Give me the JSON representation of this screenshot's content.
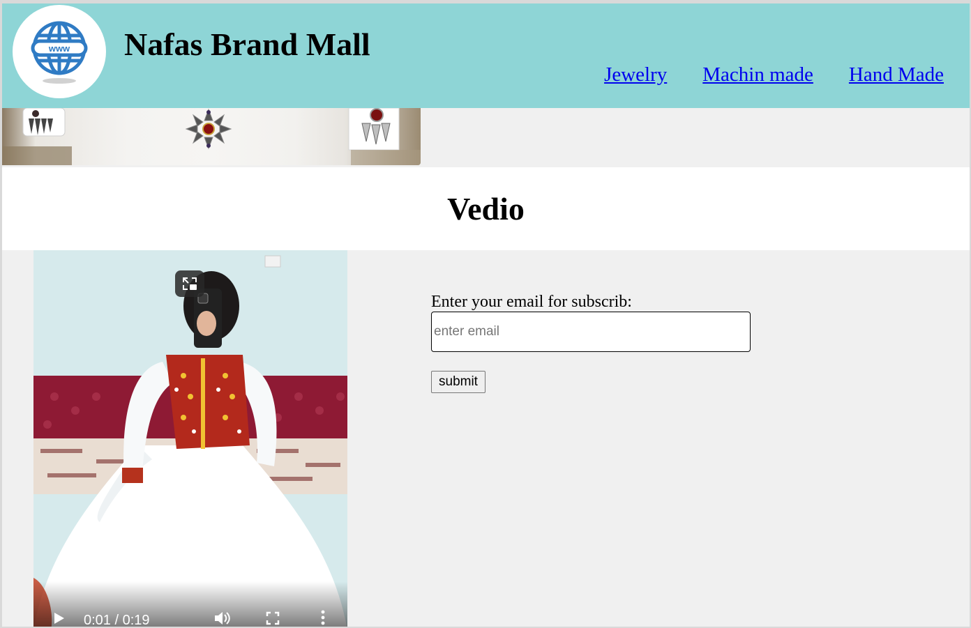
{
  "site": {
    "title": "Nafas Brand Mall",
    "logo_icon": "globe-www-icon",
    "logo_text": "www"
  },
  "nav": {
    "items": [
      {
        "label": "Jewelry"
      },
      {
        "label": "Machin made"
      },
      {
        "label": "Hand Made"
      }
    ]
  },
  "video_section": {
    "heading": "Vedio",
    "video": {
      "current_time": "0:01",
      "duration": "0:19",
      "time_display": "0:01 / 0:19",
      "progress": 0.05,
      "controls": [
        "play-icon",
        "volume-icon",
        "fullscreen-icon",
        "more-options-icon",
        "picture-in-picture-icon"
      ]
    }
  },
  "subscribe": {
    "label": "Enter your email for subscrib:",
    "email_placeholder": "enter email",
    "email_value": "",
    "submit_label": "submit"
  },
  "colors": {
    "header_bg": "#8ed5d6",
    "page_bg": "#f0f0f0",
    "link": "#0000ee",
    "logo_blue": "#2f7bc4"
  }
}
